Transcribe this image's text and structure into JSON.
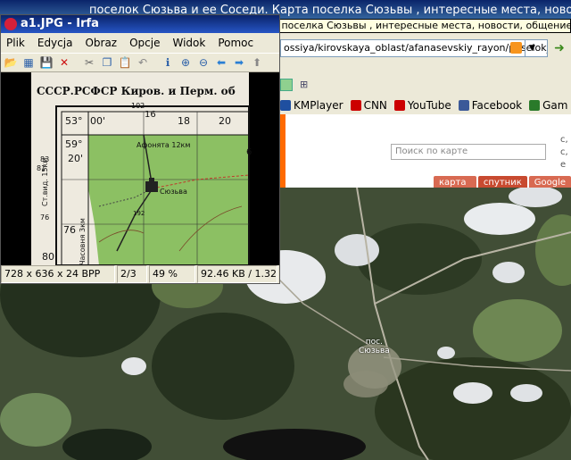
{
  "browser": {
    "title": "поселок Сюзьва и ее Соседи. Карта поселка Сюзьвы , интересные места, новости, общение. (Кировская",
    "tooltip": "поселок Сюзьва и ее Соседи. Карта поселка Сюзьвы , интересные места, новости, общение. (Кировская",
    "address": "ossiya/kirovskaya_oblast/afanasevskiy_rayon/poselok_",
    "bookmarks": [
      {
        "label": "KMPlayer",
        "icon": "kmplayer-icon",
        "color": "#1f4fa0"
      },
      {
        "label": "CNN",
        "icon": "cnn-icon",
        "color": "#cc0000"
      },
      {
        "label": "YouTube",
        "icon": "youtube-icon",
        "color": "#cc0000"
      },
      {
        "label": "Facebook",
        "icon": "facebook-icon",
        "color": "#3b5998"
      },
      {
        "label": "Gam",
        "icon": "games-icon",
        "color": "#2a7a2a"
      }
    ],
    "search_placeholder": "Поиск по карте",
    "map_tabs": [
      "карта дорог",
      "спутник",
      "Google"
    ],
    "side_text": "с, с, е",
    "place_label_1": "пос.",
    "place_label_2": "Сюзьва"
  },
  "irfan": {
    "title": "a1.JPG - Irfa",
    "menu": [
      "Plik",
      "Edycja",
      "Obraz",
      "Opcje",
      "Widok",
      "Pomoc"
    ],
    "toolbar": [
      {
        "name": "open-icon",
        "glyph": "📂"
      },
      {
        "name": "slideshow-icon",
        "glyph": "▦"
      },
      {
        "name": "save-icon",
        "glyph": "💾"
      },
      {
        "name": "delete-icon",
        "glyph": "✕"
      },
      {
        "name": "cut-icon",
        "glyph": "✂"
      },
      {
        "name": "copy-icon",
        "glyph": "❐"
      },
      {
        "name": "paste-icon",
        "glyph": "📋"
      },
      {
        "name": "undo-icon",
        "glyph": "↶"
      },
      {
        "name": "info-icon",
        "glyph": "ℹ"
      },
      {
        "name": "zoom-in-icon",
        "glyph": "⊕"
      },
      {
        "name": "zoom-out-icon",
        "glyph": "⊖"
      },
      {
        "name": "prev-icon",
        "glyph": "⬅"
      },
      {
        "name": "next-icon",
        "glyph": "➡"
      },
      {
        "name": "upload-icon",
        "glyph": "⬆"
      }
    ],
    "status": {
      "dimensions": "728 x 636 x 24 BPP",
      "page": "2/3",
      "zoom": "49 %",
      "size": "92.46 KB / 1.32"
    },
    "map_image": {
      "header": "СССР.РСФСР Киров. и Перм. об",
      "place": "Сюзьва",
      "road": "Афонята 12км",
      "lat1": "53°",
      "min1": "00'",
      "lat2": "59°",
      "min2": "20'",
      "x1": "16",
      "x2": "76",
      "x3": "18",
      "x4": "20",
      "y1": "83",
      "y2": "76",
      "y3": "80",
      "num": "102",
      "elev": "192",
      "side1": "Ст.вид. 15км",
      "side2": "Часовня 3км",
      "n1": "81",
      "n2": "6"
    }
  }
}
